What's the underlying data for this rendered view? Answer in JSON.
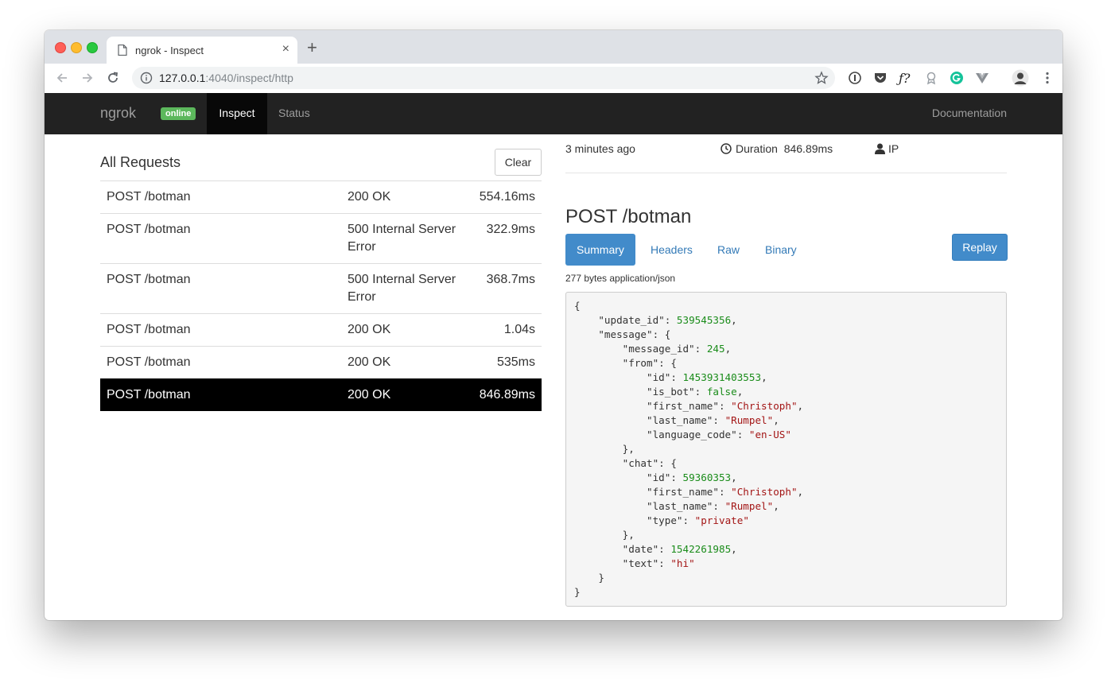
{
  "browser": {
    "tab_title": "ngrok - Inspect",
    "url_host": "127.0.0.1",
    "url_rest": ":4040/inspect/http"
  },
  "navbar": {
    "brand": "ngrok",
    "badge": "online",
    "tabs": [
      "Inspect",
      "Status"
    ],
    "documentation": "Documentation"
  },
  "requests": {
    "title": "All Requests",
    "clear_label": "Clear",
    "rows": [
      {
        "path": "POST /botman",
        "status": "200 OK",
        "duration": "554.16ms"
      },
      {
        "path": "POST /botman",
        "status": "500 Internal Server Error",
        "duration": "322.9ms"
      },
      {
        "path": "POST /botman",
        "status": "500 Internal Server Error",
        "duration": "368.7ms"
      },
      {
        "path": "POST /botman",
        "status": "200 OK",
        "duration": "1.04s"
      },
      {
        "path": "POST /botman",
        "status": "200 OK",
        "duration": "535ms"
      },
      {
        "path": "POST /botman",
        "status": "200 OK",
        "duration": "846.89ms"
      }
    ],
    "selected_index": 5
  },
  "detail": {
    "time_ago": "3 minutes ago",
    "duration_label": "Duration",
    "duration_value": "846.89ms",
    "ip_label": "IP",
    "heading": "POST /botman",
    "tabs": [
      "Summary",
      "Headers",
      "Raw",
      "Binary"
    ],
    "active_tab": "Summary",
    "replay_label": "Replay",
    "body_info": "277 bytes application/json",
    "json": {
      "update_id": 539545356,
      "message": {
        "message_id": 245,
        "from": {
          "id": 1453931403553,
          "is_bot": false,
          "first_name": "Christoph",
          "last_name": "Rumpel",
          "language_code": "en-US"
        },
        "chat": {
          "id": 59360353,
          "first_name": "Christoph",
          "last_name": "Rumpel",
          "type": "private"
        },
        "date": 1542261985,
        "text": "hi"
      }
    }
  },
  "colors": {
    "navbar_bg": "#222222",
    "badge_green": "#5cb85c",
    "primary_blue": "#428bca",
    "selected_row": "#000000",
    "json_number": "#1a8c1a",
    "json_string": "#a31515"
  }
}
